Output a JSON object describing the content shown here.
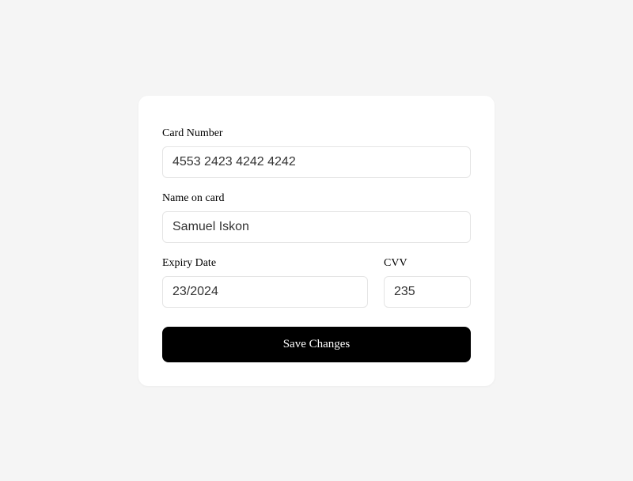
{
  "form": {
    "card_number": {
      "label": "Card Number",
      "value": "4553 2423 4242 4242"
    },
    "name_on_card": {
      "label": "Name on card",
      "value": "Samuel Iskon"
    },
    "expiry_date": {
      "label": "Expiry Date",
      "value": "23/2024"
    },
    "cvv": {
      "label": "CVV",
      "value": "235"
    },
    "save_button_label": "Save Changes"
  }
}
